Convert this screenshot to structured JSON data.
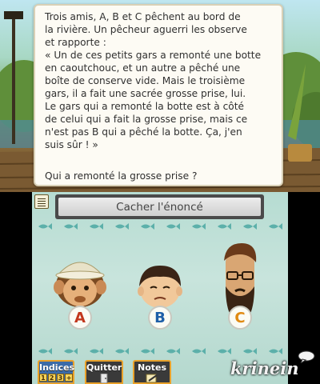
{
  "puzzle": {
    "text": "Trois amis, A, B et C pêchent au bord de\nla rivière. Un pêcheur aguerri les observe\net rapporte :\n« Un de ces petits gars a remonté une botte\nen caoutchouc, et un autre a pêché une\nboîte de conserve vide. Mais le troisième\ngars, il a fait une sacrée grosse prise, lui.\nLe gars qui a remonté la botte est à côté\nde celui qui a fait la grosse prise, mais ce\nn'est pas B qui a pêché la botte. Ça, j'en\nsuis sûr ! »",
    "question": "Qui a remonté la grosse prise ?"
  },
  "controls": {
    "toggle_label": "Cacher l'énoncé",
    "hints_label": "Indices",
    "hint_levels": [
      "1",
      "2",
      "3",
      "+"
    ],
    "quit_label": "Quitter",
    "notes_label": "Notes"
  },
  "suspects": [
    {
      "letter": "A",
      "color": "#c2361c"
    },
    {
      "letter": "B",
      "color": "#1e5fa8"
    },
    {
      "letter": "C",
      "color": "#e08a12"
    }
  ],
  "watermark": "krinein"
}
